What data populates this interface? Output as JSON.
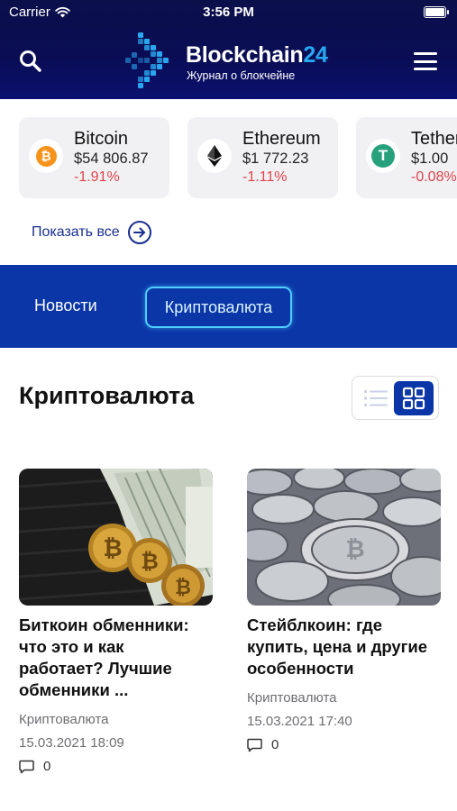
{
  "status_bar": {
    "carrier": "Carrier",
    "time": "3:56 PM"
  },
  "header": {
    "brand_main": "Blockchain",
    "brand_accent": "24",
    "tagline": "Журнал о блокчейне",
    "icons": {
      "search": "search-icon",
      "menu": "hamburger-menu-icon"
    }
  },
  "coins": [
    {
      "name": "Bitcoin",
      "price": "$54 806.87",
      "change": "-1.91%",
      "symbol": "₿",
      "color": "#f7931a"
    },
    {
      "name": "Ethereum",
      "price": "$1 772.23",
      "change": "-1.11%",
      "symbol": "ethereum-icon",
      "color": "#111111"
    },
    {
      "name": "Tether",
      "price": "$1.00",
      "change": "-0.08%",
      "symbol": "T",
      "color": "#26a17b"
    }
  ],
  "show_all_label": "Показать все",
  "tabs": [
    {
      "label": "Новости",
      "active": false
    },
    {
      "label": "Криптовалюта",
      "active": true
    }
  ],
  "section_title": "Криптовалюта",
  "view_mode": "grid",
  "articles": [
    {
      "title": "Биткоин обменники: что это и как работает? Лучшие обменники ...",
      "category": "Криптовалюта",
      "date": "15.03.2021 18:09",
      "comments": "0"
    },
    {
      "title": "Стейблкоин: где купить, цена и другие особенности",
      "category": "Криптовалюта",
      "date": "15.03.2021 17:40",
      "comments": "0"
    }
  ],
  "colors": {
    "header_bg": "#0b0f4a",
    "accent_blue": "#27a7f0",
    "tabs_bg": "#0b36a8",
    "active_tab_border": "#4fd0ff",
    "negative": "#e0434b",
    "link": "#1a2f8f"
  }
}
